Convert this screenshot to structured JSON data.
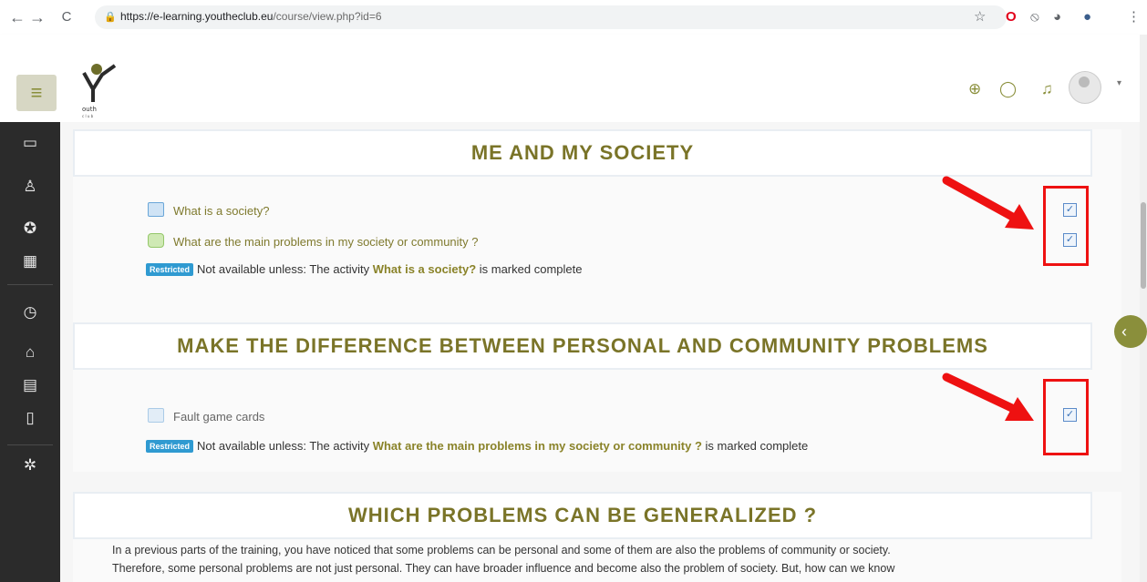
{
  "browser": {
    "back": "←",
    "forward": "→",
    "reload": "C",
    "url_host": "https://e-learning.youtheclub.eu",
    "url_path": "/course/view.php?id=6",
    "lock": "🔒",
    "star": "☆",
    "ext1": "O",
    "ext2": "⦸",
    "ext3": "◕",
    "ext4": "●",
    "menu": "⋮"
  },
  "header": {
    "hamburger": "≡",
    "globe": "⊕",
    "messages": "◯",
    "notifications": "♫",
    "caret": "▾"
  },
  "logo_text": "Youth Entrepreneurs Club",
  "rail": {
    "folder": "▭",
    "participants": "♙",
    "badges": "✪",
    "grades": "▦",
    "dashboard": "◷",
    "home": "⌂",
    "calendar": "▤",
    "files": "▯",
    "settings": "✲"
  },
  "sections": [
    {
      "title": "ME AND MY SOCIETY",
      "activities": [
        {
          "label": "What is a society?"
        },
        {
          "label": "What are the main problems in my society or community ?"
        }
      ],
      "restriction": {
        "badge": "Restricted",
        "prefix": "Not available unless: The activity ",
        "activity": "What is a society?",
        "suffix": " is marked complete"
      }
    },
    {
      "title": "MAKE THE DIFFERENCE BETWEEN PERSONAL AND COMMUNITY PROBLEMS",
      "activities": [
        {
          "label": "Fault game cards"
        }
      ],
      "restriction": {
        "badge": "Restricted",
        "prefix": "Not available unless: The activity ",
        "activity": "What are the main problems in my society or community ?",
        "suffix": " is marked complete"
      }
    },
    {
      "title": "WHICH PROBLEMS CAN BE GENERALIZED ?",
      "paragraph_line1": "In a previous parts of the training, you have noticed that some problems can be personal and some of them are also the problems of community or society.",
      "paragraph_line2": "Therefore, some personal problems are not just personal. They can have broader influence and become also the problem of society. But, how can we know"
    }
  ],
  "checkmark": "✓",
  "drawer_toggle": "‹",
  "colors": {
    "accent": "#8a8f3b",
    "title": "#7a7428",
    "restricted_badge": "#2f9ad1",
    "annotation_red": "#ee1111"
  }
}
